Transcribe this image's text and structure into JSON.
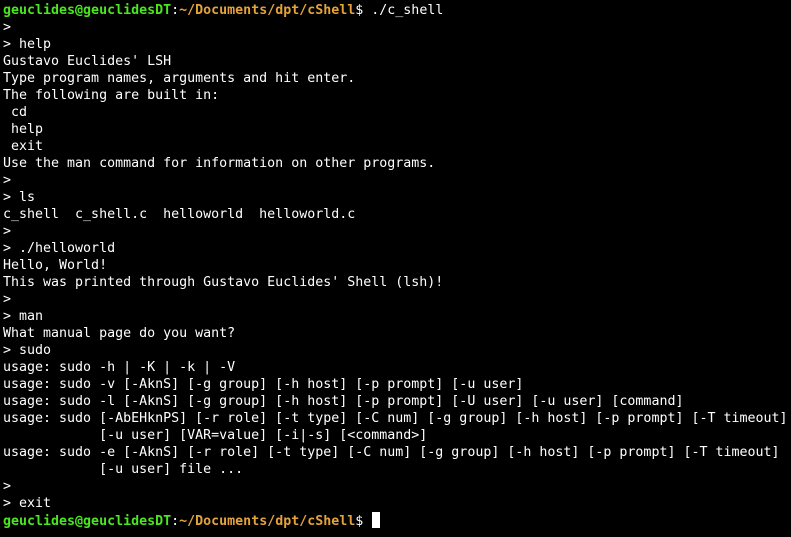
{
  "terminal": {
    "colors": {
      "background": "#000000",
      "text": "#ffffff",
      "user": "#4ae61e",
      "path": "#e3a23b",
      "cursor": "#ffffff"
    },
    "first_prompt": {
      "user_host": "geuclides@geuclidesDT",
      "separator": ":",
      "path": "~/Documents/dpt/cShell",
      "symbol": "$ ",
      "command": "./c_shell"
    },
    "output_lines": [
      ">",
      "> help",
      "Gustavo Euclides' LSH",
      "Type program names, arguments and hit enter.",
      "The following are built in:",
      " cd",
      " help",
      " exit",
      "Use the man command for information on other programs.",
      ">",
      "> ls",
      "c_shell  c_shell.c  helloworld  helloworld.c",
      ">",
      "> ./helloworld",
      "Hello, World!",
      "This was printed through Gustavo Euclides' Shell (lsh)!",
      ">",
      "> man",
      "What manual page do you want?",
      "> sudo",
      "usage: sudo -h | -K | -k | -V",
      "usage: sudo -v [-AknS] [-g group] [-h host] [-p prompt] [-u user]",
      "usage: sudo -l [-AknS] [-g group] [-h host] [-p prompt] [-U user] [-u user] [command]",
      "usage: sudo [-AbEHknPS] [-r role] [-t type] [-C num] [-g group] [-h host] [-p prompt] [-T timeout]",
      "            [-u user] [VAR=value] [-i|-s] [<command>]",
      "usage: sudo -e [-AknS] [-r role] [-t type] [-C num] [-g group] [-h host] [-p prompt] [-T timeout]",
      "            [-u user] file ...",
      ">",
      "> exit"
    ],
    "last_prompt": {
      "user_host": "geuclides@geuclidesDT",
      "separator": ":",
      "path": "~/Documents/dpt/cShell",
      "symbol": "$ "
    }
  }
}
